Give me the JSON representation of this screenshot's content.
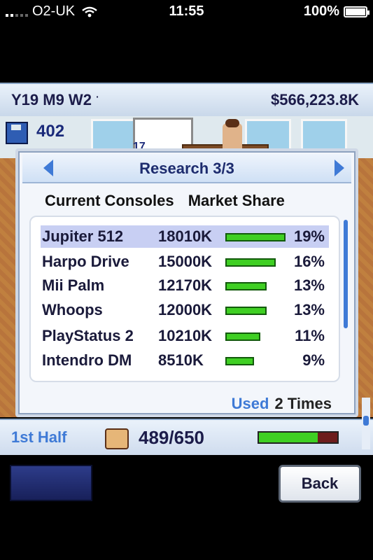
{
  "status_bar": {
    "carrier": "O2-UK",
    "time": "11:55",
    "battery": "100%"
  },
  "top_bar": {
    "date": "Y19 M9 W2",
    "dot": "·",
    "money": "$566,223.8K"
  },
  "background": {
    "save_count": "402",
    "partial_number": "17"
  },
  "dialog": {
    "title": "Research 3/3",
    "column_headers": [
      "Current Consoles",
      "Market Share"
    ],
    "rows": [
      {
        "name": "Jupiter 512",
        "units": "18010K",
        "share": "19%",
        "bar_value": 19,
        "selected": true
      },
      {
        "name": "Harpo Drive",
        "units": "15000K",
        "share": "16%",
        "bar_value": 16,
        "selected": false
      },
      {
        "name": "Mii Palm",
        "units": "12170K",
        "share": "13%",
        "bar_value": 13,
        "selected": false
      },
      {
        "name": "Whoops",
        "units": "12000K",
        "share": "13%",
        "bar_value": 13,
        "selected": false
      },
      {
        "name": "PlayStatus 2",
        "units": "10210K",
        "share": "11%",
        "bar_value": 11,
        "selected": false
      },
      {
        "name": "Intendro DM",
        "units": "8510K",
        "share": "9%",
        "bar_value": 9,
        "selected": false
      }
    ],
    "used_label": "Used",
    "used_value": "2 Times"
  },
  "bottom_bar": {
    "period": "1st Half",
    "progress_text": "489/650",
    "progress_fraction": 0.752
  },
  "buttons": {
    "back": "Back"
  },
  "colors": {
    "accent_blue": "#3f7ad6",
    "bar_green": "#3fcf23",
    "selected_row": "#c8cff3",
    "dark_navy": "#1c1c4a"
  }
}
